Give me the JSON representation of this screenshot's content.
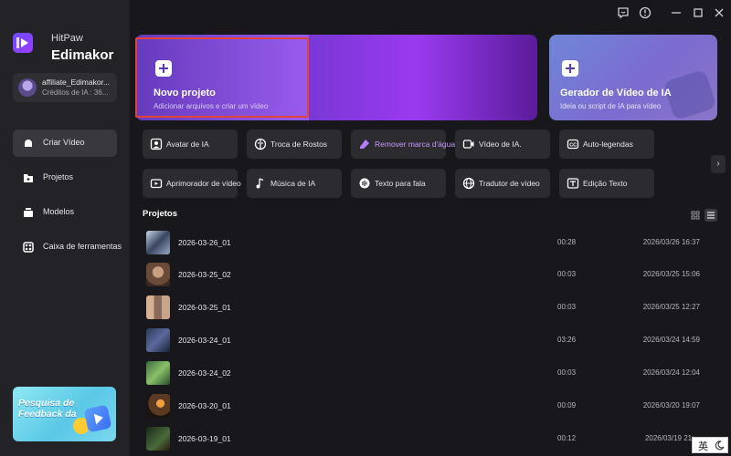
{
  "brand": {
    "top": "HitPaw",
    "main": "Edimakor"
  },
  "account": {
    "name": "affiliate_Edimakor...",
    "credits": "Créditos de IA : 36..."
  },
  "nav": [
    {
      "label": "Criar Vídeo",
      "icon": "create-video-icon",
      "active": true
    },
    {
      "label": "Projetos",
      "icon": "projects-icon",
      "active": false
    },
    {
      "label": "Modelos",
      "icon": "templates-icon",
      "active": false
    },
    {
      "label": "Caixa de ferramentas",
      "icon": "toolbox-icon",
      "active": false
    }
  ],
  "feedback": {
    "text": "Pesquisa de Feedback da"
  },
  "hero": {
    "new_project": {
      "title": "Novo projeto",
      "subtitle": "Adicionar arquivos e criar um vídeo"
    },
    "ai_generator": {
      "title": "Gerador de Vídeo de IA",
      "subtitle": "Ideia ou script de IA para vídeo"
    }
  },
  "tools": [
    {
      "label": "Avatar de IA",
      "icon": "avatar-icon"
    },
    {
      "label": "Troca de Rostos",
      "icon": "face-swap-icon"
    },
    {
      "label": "Remover marca d'água",
      "icon": "watermark-remove-icon",
      "highlight": true
    },
    {
      "label": "Vídeo de IA.",
      "icon": "ai-video-icon"
    },
    {
      "label": "Auto-legendas",
      "icon": "subtitles-icon"
    },
    {
      "label": "Aprimorador de vídeo",
      "icon": "video-enhancer-icon"
    },
    {
      "label": "Música de IA",
      "icon": "music-icon"
    },
    {
      "label": "Texto para fala",
      "icon": "text-to-speech-icon"
    },
    {
      "label": "Tradutor de vídeo",
      "icon": "translator-icon"
    },
    {
      "label": "Edição Texto",
      "icon": "text-edit-icon"
    }
  ],
  "projects": {
    "heading": "Projetos",
    "rows": [
      {
        "name": "2026-03-26_01",
        "duration": "00:28",
        "date": "2026/03/26 16:37"
      },
      {
        "name": "2026-03-25_02",
        "duration": "00:03",
        "date": "2026/03/25 15:06"
      },
      {
        "name": "2026-03-25_01",
        "duration": "00:03",
        "date": "2026/03/25 12:27"
      },
      {
        "name": "2026-03-24_01",
        "duration": "03:26",
        "date": "2026/03/24 14:59"
      },
      {
        "name": "2026-03-24_02",
        "duration": "00:03",
        "date": "2026/03/24 12:04"
      },
      {
        "name": "2026-03-20_01",
        "duration": "00:09",
        "date": "2026/03/20 19:07"
      },
      {
        "name": "2026-03-19_01",
        "duration": "00:12",
        "date": "2026/03/19 21:..."
      }
    ]
  },
  "ime": {
    "lang": "英"
  },
  "colors": {
    "accent": "#9a3af0",
    "highlight_border": "#e0443c",
    "tool_highlight_text": "#c79aff"
  }
}
